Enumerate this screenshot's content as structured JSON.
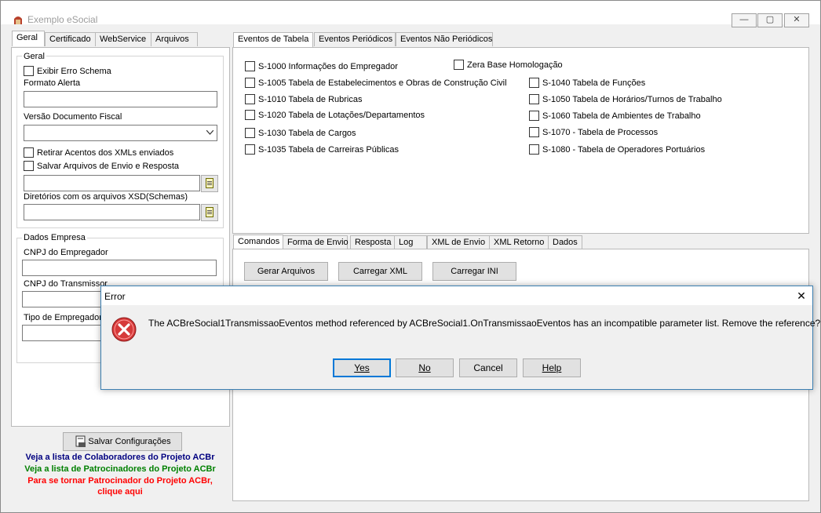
{
  "window": {
    "title": "Exemplo eSocial",
    "minimize": "—",
    "maximize": "▢",
    "close": "✕"
  },
  "left_tabs": [
    "Geral",
    "Certificado",
    "WebService",
    "Arquivos"
  ],
  "geral": {
    "group_title": "Geral",
    "exibir_erro_schema": "Exibir Erro Schema",
    "formato_alerta_label": "Formato Alerta",
    "formato_alerta_value": "",
    "versao_doc_label": "Versão Documento Fiscal",
    "versao_doc_value": "",
    "retirar_acentos": "Retirar Acentos dos XMLs enviados",
    "salvar_arquivos": "Salvar Arquivos de Envio e Resposta",
    "salvar_path_value": "",
    "diretorios_xsd_label": "Diretórios com os arquivos XSD(Schemas)",
    "diretorios_xsd_value": ""
  },
  "dados_empresa": {
    "group_title": "Dados Empresa",
    "cnpj_empregador_label": "CNPJ do Empregador",
    "cnpj_transmissor_label": "CNPJ do Transmissor",
    "tipo_empregador_label": "Tipo de Empregador"
  },
  "save_button": "Salvar Configurações",
  "links": {
    "colaboradores": "Veja a lista de Colaboradores do Projeto ACBr",
    "patrocinadores": "Veja a lista de Patrocinadores do Projeto ACBr",
    "tornar_line1": "Para se tornar Patrocinador do Projeto ACBr,",
    "tornar_line2": "clique aqui",
    "colors": {
      "blue": "#000080",
      "green": "#008000",
      "red": "#ff0000"
    }
  },
  "right_tabs": [
    "Eventos de Tabela",
    "Eventos Periódicos",
    "Eventos Não Periódicos"
  ],
  "eventos": {
    "left": [
      "S-1000 Informações do Empregador",
      "S-1005 Tabela de Estabelecimentos e Obras de Construção Civil",
      "S-1010 Tabela de Rubricas",
      "S-1020 Tabela de Lotações/Departamentos",
      "S-1030 Tabela de Cargos",
      "S-1035 Tabela de Carreiras Públicas"
    ],
    "zera_base": "Zera Base Homologação",
    "right": [
      "S-1040 Tabela de Funções",
      "S-1050 Tabela de Horários/Turnos de Trabalho",
      "S-1060 Tabela de Ambientes de Trabalho",
      "S-1070 - Tabela de Processos",
      "S-1080 - Tabela de Operadores Portuários"
    ]
  },
  "bottom_tabs": [
    "Comandos",
    "Forma de Envio",
    "Resposta",
    "Log",
    "XML de Envio",
    "XML Retorno",
    "Dados"
  ],
  "comandos": {
    "gerar": "Gerar Arquivos",
    "carregar_xml": "Carregar XML",
    "carregar_ini": "Carregar INI"
  },
  "dialog": {
    "title": "Error",
    "close": "✕",
    "message": "The ACBreSocial1TransmissaoEventos method referenced by ACBreSocial1.OnTransmissaoEventos has an incompatible parameter list. Remove the reference?",
    "buttons": {
      "yes": "Yes",
      "no": "No",
      "cancel": "Cancel",
      "help": "Help"
    },
    "icon": "error-icon"
  }
}
